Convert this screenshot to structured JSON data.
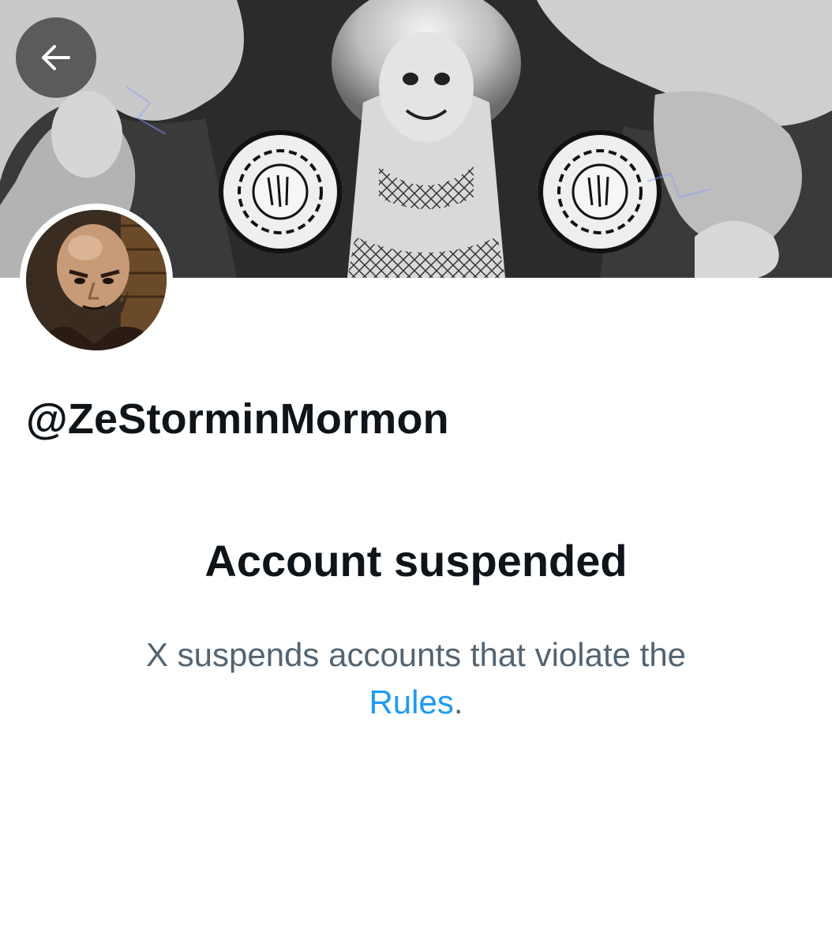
{
  "header": {
    "back_icon": "arrow-left-icon",
    "banner_description": "Black-and-white illustrated artwork banner"
  },
  "profile": {
    "avatar_description": "bald bearded man portrait",
    "handle": "@ZeStorminMormon"
  },
  "suspension": {
    "title": "Account suspended",
    "message_prefix": "X suspends accounts that violate the",
    "rules_link": "Rules",
    "message_suffix": "."
  },
  "colors": {
    "primary_text": "#0f1419",
    "secondary_text": "#536471",
    "link": "#1d9bf0"
  }
}
